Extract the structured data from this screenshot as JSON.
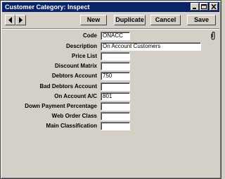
{
  "window": {
    "title": "Customer Category: Inspect"
  },
  "toolbar": {
    "new_label": "New",
    "duplicate_label": "Duplicate",
    "cancel_label": "Cancel",
    "save_label": "Save"
  },
  "fields": [
    {
      "label": "Code",
      "value": "ONACC"
    },
    {
      "label": "Description",
      "value": "On Account Customers"
    },
    {
      "label": "Price List",
      "value": ""
    },
    {
      "label": "Discount Matrix",
      "value": ""
    },
    {
      "label": "Debtors Account",
      "value": "750"
    },
    {
      "label": "Bad Debtors Account",
      "value": ""
    },
    {
      "label": "On Account A/C",
      "value": "801"
    },
    {
      "label": "Down Payment Percentage",
      "value": ""
    },
    {
      "label": "Web Order Class",
      "value": ""
    },
    {
      "label": "Main Classification",
      "value": ""
    }
  ],
  "icons": {
    "prev": "arrow-left-icon",
    "next": "arrow-right-icon",
    "attachment": "paperclip-icon",
    "minimize": "minimize-icon",
    "maximize": "maximize-icon",
    "close": "close-icon"
  },
  "colors": {
    "titlebar": "#0a246a",
    "window": "#d4d0c8"
  }
}
